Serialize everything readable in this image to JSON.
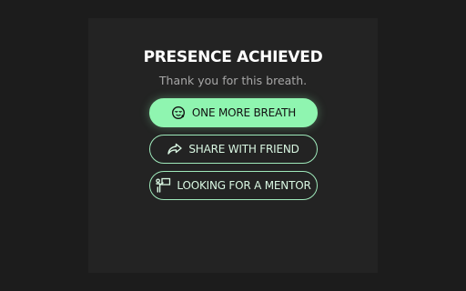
{
  "completion": {
    "title": "PRESENCE ACHIEVED",
    "subtitle": "Thank you for this breath.",
    "actions": [
      {
        "label": "ONE MORE BREATH",
        "icon": "relieved-face-icon",
        "style": "primary"
      },
      {
        "label": "SHARE WITH FRIEND",
        "icon": "share-arrow-icon",
        "style": "outline"
      },
      {
        "label": "LOOKING FOR A MENTOR",
        "icon": "mentor-board-icon",
        "style": "outline"
      }
    ]
  },
  "colors": {
    "background": "#1c1c1c",
    "card": "#232323",
    "accent": "#8ff5b0",
    "outline": "#9fe9bb",
    "title": "#ffffff",
    "subtitle": "#a7a7a7"
  }
}
